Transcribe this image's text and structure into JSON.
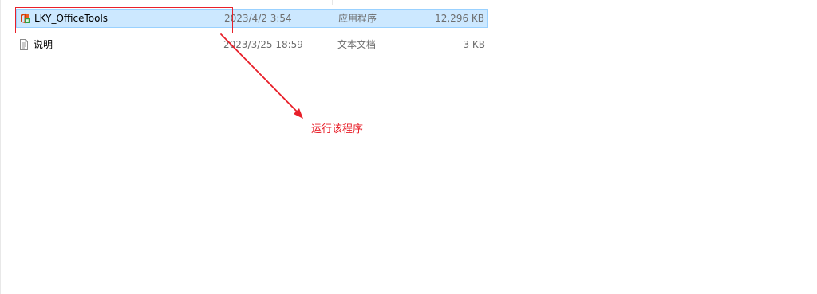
{
  "files": [
    {
      "name": "LKY_OfficeTools",
      "date_modified": "2023/4/2 3:54",
      "type": "应用程序",
      "size": "12,296 KB",
      "icon": "office-app-icon",
      "selected": true
    },
    {
      "name": "说明",
      "date_modified": "2023/3/25 18:59",
      "type": "文本文档",
      "size": "3 KB",
      "icon": "text-document-icon",
      "selected": false
    }
  ],
  "annotation": {
    "text": "运行该程序",
    "color": "#e8202a"
  },
  "colors": {
    "selection_background": "#cce8ff",
    "selection_border": "#99d1ff",
    "secondary_text": "#6d6d6d"
  }
}
